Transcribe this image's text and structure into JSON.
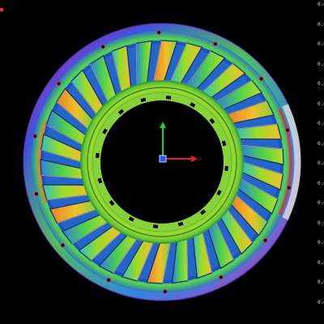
{
  "viewer": {
    "title": "",
    "background_color": "#000000",
    "model": "turbine-stator-ring",
    "deviation_colormap": [
      "#2b2bd6",
      "#2f8fe8",
      "#27c7b6",
      "#4fd24a",
      "#b8dc2a",
      "#f0c02a",
      "#f07a22",
      "#e8322a",
      "#c83ab8"
    ],
    "blade_count": 30
  },
  "axis_triad": {
    "x_color": "#e02020",
    "y_color": "#20d020",
    "z_color": "#3050ff",
    "x_label": "x",
    "icon": "xyz-axis-triad-icon"
  },
  "colorbar_ticks": [
    "0.0",
    "0.0",
    "0.0",
    "0.0",
    "0.0",
    "0.0",
    "0.0",
    "0.0",
    "0.0",
    "0.0",
    "0.0",
    "0.0",
    "0.0",
    "0.0",
    "0.0",
    "0.0"
  ]
}
